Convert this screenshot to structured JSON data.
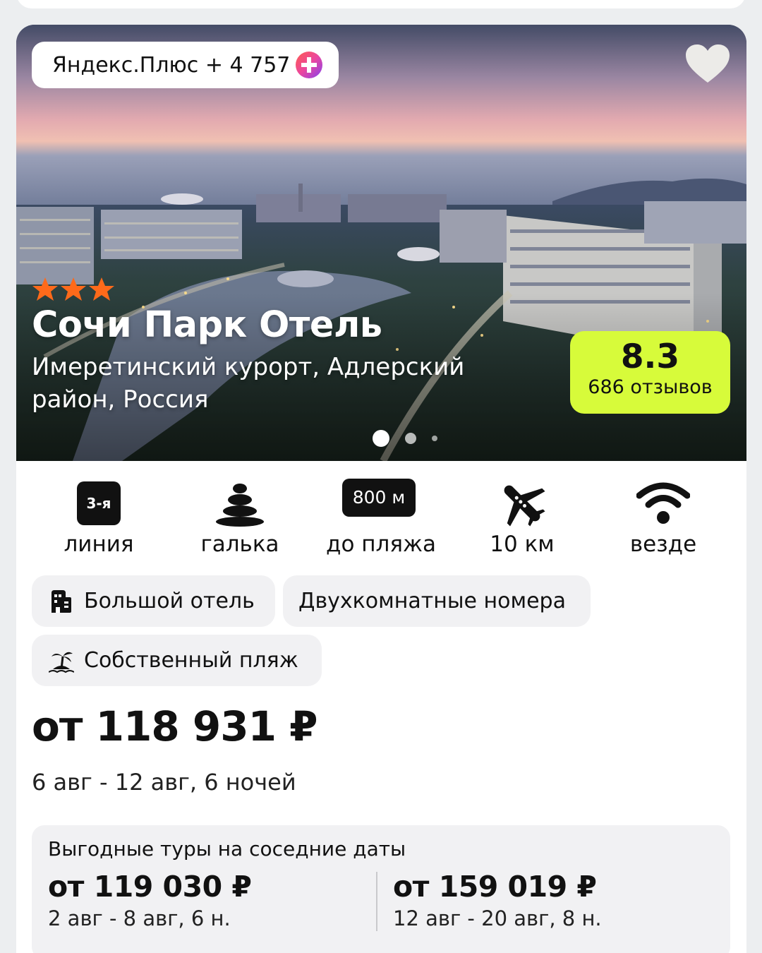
{
  "hotel": {
    "plus_label": "Яндекс.Плюс + 4 757",
    "stars": 3,
    "name": "Сочи Парк Отель",
    "location": "Имеретинский курорт, Адлерский район, Россия",
    "rating": "8.3",
    "reviews": "686 отзывов",
    "photos_total": 3,
    "photo_active": 1
  },
  "features": [
    {
      "badge": "3-я",
      "label": "линия",
      "icon": "beach-line-badge"
    },
    {
      "label": "галька",
      "icon": "pebbles-icon"
    },
    {
      "badge": "800 м",
      "label": "до пляжа",
      "icon": "distance-badge"
    },
    {
      "label": "10 км",
      "icon": "airplane-icon"
    },
    {
      "label": "везде",
      "icon": "wifi-icon"
    }
  ],
  "tags": [
    {
      "label": "Большой отель",
      "icon": "building-icon"
    },
    {
      "label": "Двухкомнатные номера"
    },
    {
      "label": "Собственный пляж",
      "icon": "island-icon"
    }
  ],
  "price": "от 118 931 ₽",
  "dates": "6 авг - 12 авг, 6 ночей",
  "nearby": {
    "title": "Выгодные туры на соседние даты",
    "tours": [
      {
        "price": "от 119 030 ₽",
        "dates": "2 авг - 8 авг, 6 н."
      },
      {
        "price": "от 159 019 ₽",
        "dates": "12 авг - 20 авг, 8 н."
      }
    ]
  },
  "colors": {
    "rating_badge": "#d7fb3a",
    "star": "#ff6a1a",
    "chip_bg": "#f1f1f3"
  }
}
